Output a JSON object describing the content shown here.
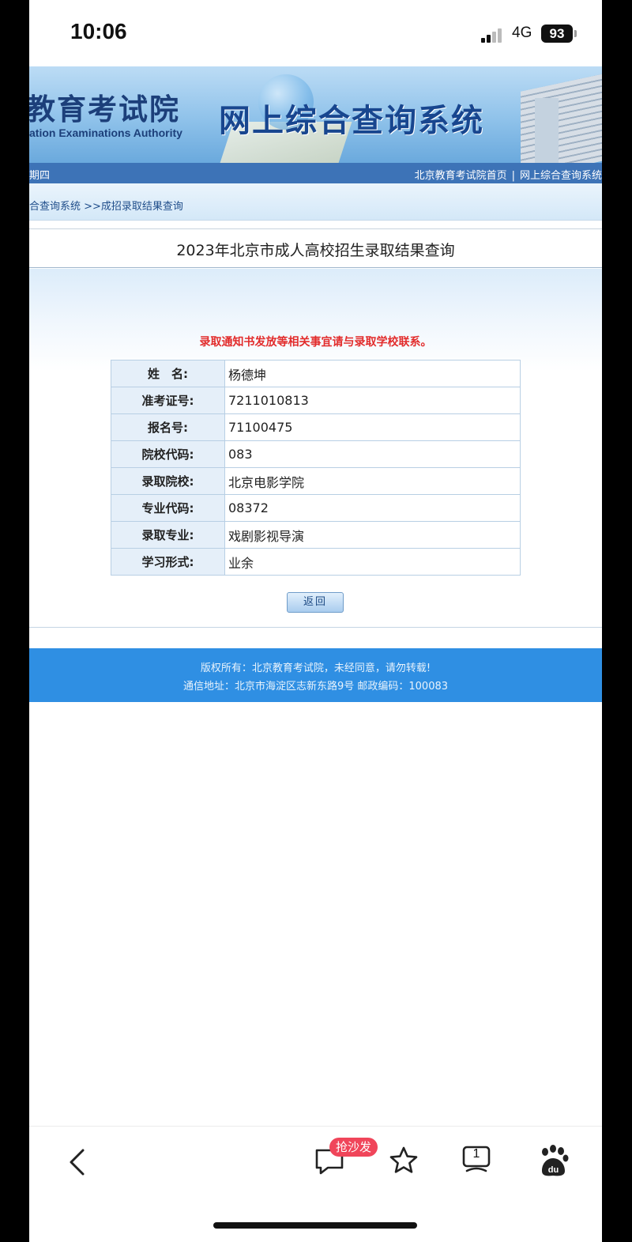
{
  "status_bar": {
    "time": "10:06",
    "network": "4G",
    "battery": "93"
  },
  "banner": {
    "logo_cn": "教育考试院",
    "logo_en": "ation Examinations Authority",
    "system_title": "网上综合查询系统"
  },
  "nav": {
    "date": "期四",
    "links": [
      "北京教育考试院首页",
      "网上综合查询系统"
    ],
    "separator": "|"
  },
  "breadcrumb": "合查询系统 >>成招录取结果查询",
  "page_title": "2023年北京市成人高校招生录取结果查询",
  "notice": "录取通知书发放等相关事宜请与录取学校联系。",
  "result_rows": [
    {
      "label": "姓　名:",
      "value": "杨德坤"
    },
    {
      "label": "准考证号:",
      "value": "7211010813"
    },
    {
      "label": "报名号:",
      "value": "71100475"
    },
    {
      "label": "院校代码:",
      "value": "083"
    },
    {
      "label": "录取院校:",
      "value": "北京电影学院"
    },
    {
      "label": "专业代码:",
      "value": "08372"
    },
    {
      "label": "录取专业:",
      "value": "戏剧影视导演"
    },
    {
      "label": "学习形式:",
      "value": "业余"
    }
  ],
  "back_button": "返回",
  "footer": {
    "copyright": "版权所有：北京教育考试院，未经同意，请勿转载!",
    "address": "通信地址：北京市海淀区志新东路9号 邮政编码：100083"
  },
  "toolbar": {
    "comment_badge": "抢沙发",
    "tab_count": "1",
    "icons": [
      "back-icon",
      "comment-icon",
      "star-icon",
      "tabs-icon",
      "baidu-icon"
    ]
  },
  "colors": {
    "nav_bar": "#3d73b7",
    "footer": "#2f8fe3",
    "notice": "#e22b2b",
    "badge": "#f0455a"
  }
}
